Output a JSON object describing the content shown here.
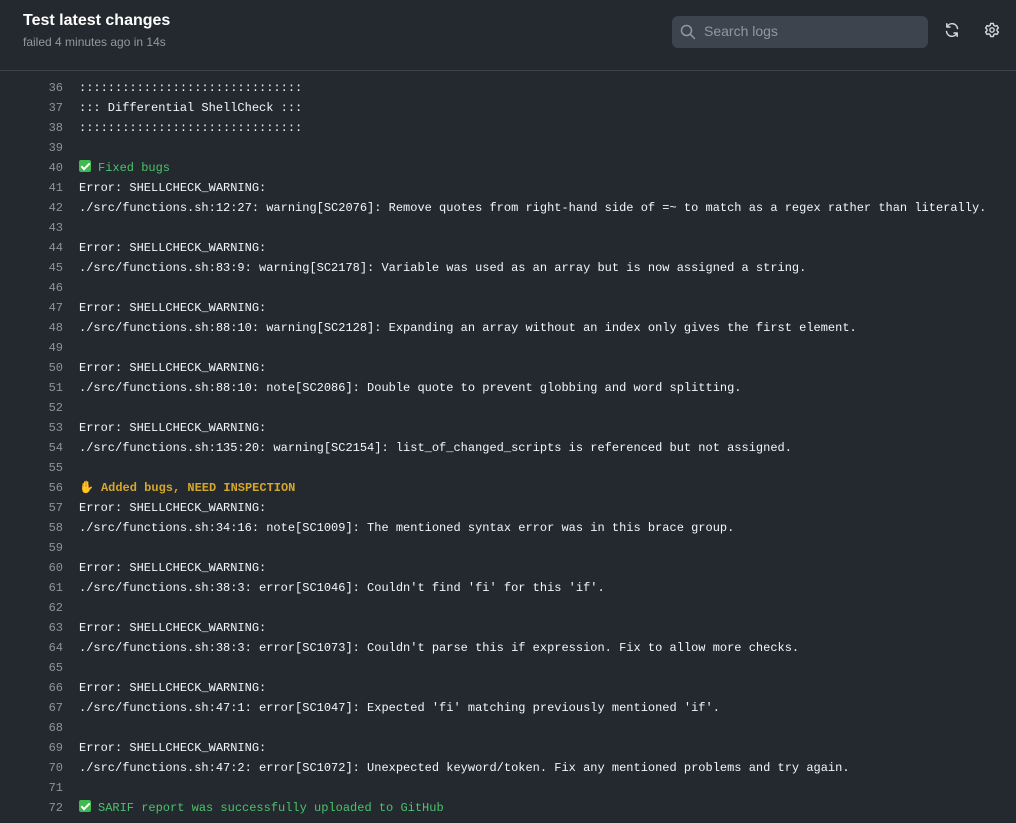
{
  "header": {
    "title": "Test latest changes",
    "subtitle": "failed 4 minutes ago in 14s"
  },
  "search": {
    "placeholder": "Search logs",
    "icon": "search-icon"
  },
  "actions": {
    "refresh_icon": "refresh-icon",
    "settings_icon": "gear-icon"
  },
  "colors": {
    "background": "#24292f",
    "search_bg": "#3d444d",
    "line_number": "#8b949e",
    "success_green": "#4ac26b",
    "warning_yellow": "#d4a72c"
  },
  "log_lines": [
    {
      "n": "36",
      "text": ":::::::::::::::::::::::::::::::",
      "style": "normal",
      "icon": ""
    },
    {
      "n": "37",
      "text": "::: Differential ShellCheck :::",
      "style": "normal",
      "icon": ""
    },
    {
      "n": "38",
      "text": ":::::::::::::::::::::::::::::::",
      "style": "normal",
      "icon": ""
    },
    {
      "n": "39",
      "text": "",
      "style": "normal",
      "icon": ""
    },
    {
      "n": "40",
      "text": "Fixed bugs",
      "style": "green",
      "icon": "check"
    },
    {
      "n": "41",
      "text": "Error: SHELLCHECK_WARNING:",
      "style": "normal",
      "icon": ""
    },
    {
      "n": "42",
      "text": "./src/functions.sh:12:27: warning[SC2076]: Remove quotes from right-hand side of =~ to match as a regex rather than literally.",
      "style": "normal",
      "icon": ""
    },
    {
      "n": "43",
      "text": "",
      "style": "normal",
      "icon": ""
    },
    {
      "n": "44",
      "text": "Error: SHELLCHECK_WARNING:",
      "style": "normal",
      "icon": ""
    },
    {
      "n": "45",
      "text": "./src/functions.sh:83:9: warning[SC2178]: Variable was used as an array but is now assigned a string.",
      "style": "normal",
      "icon": ""
    },
    {
      "n": "46",
      "text": "",
      "style": "normal",
      "icon": ""
    },
    {
      "n": "47",
      "text": "Error: SHELLCHECK_WARNING:",
      "style": "normal",
      "icon": ""
    },
    {
      "n": "48",
      "text": "./src/functions.sh:88:10: warning[SC2128]: Expanding an array without an index only gives the first element.",
      "style": "normal",
      "icon": ""
    },
    {
      "n": "49",
      "text": "",
      "style": "normal",
      "icon": ""
    },
    {
      "n": "50",
      "text": "Error: SHELLCHECK_WARNING:",
      "style": "normal",
      "icon": ""
    },
    {
      "n": "51",
      "text": "./src/functions.sh:88:10: note[SC2086]: Double quote to prevent globbing and word splitting.",
      "style": "normal",
      "icon": ""
    },
    {
      "n": "52",
      "text": "",
      "style": "normal",
      "icon": ""
    },
    {
      "n": "53",
      "text": "Error: SHELLCHECK_WARNING:",
      "style": "normal",
      "icon": ""
    },
    {
      "n": "54",
      "text": "./src/functions.sh:135:20: warning[SC2154]: list_of_changed_scripts is referenced but not assigned.",
      "style": "normal",
      "icon": ""
    },
    {
      "n": "55",
      "text": "",
      "style": "normal",
      "icon": ""
    },
    {
      "n": "56",
      "text": "Added bugs, NEED INSPECTION",
      "style": "yellow",
      "icon": "hand"
    },
    {
      "n": "57",
      "text": "Error: SHELLCHECK_WARNING:",
      "style": "normal",
      "icon": ""
    },
    {
      "n": "58",
      "text": "./src/functions.sh:34:16: note[SC1009]: The mentioned syntax error was in this brace group.",
      "style": "normal",
      "icon": ""
    },
    {
      "n": "59",
      "text": "",
      "style": "normal",
      "icon": ""
    },
    {
      "n": "60",
      "text": "Error: SHELLCHECK_WARNING:",
      "style": "normal",
      "icon": ""
    },
    {
      "n": "61",
      "text": "./src/functions.sh:38:3: error[SC1046]: Couldn't find 'fi' for this 'if'.",
      "style": "normal",
      "icon": ""
    },
    {
      "n": "62",
      "text": "",
      "style": "normal",
      "icon": ""
    },
    {
      "n": "63",
      "text": "Error: SHELLCHECK_WARNING:",
      "style": "normal",
      "icon": ""
    },
    {
      "n": "64",
      "text": "./src/functions.sh:38:3: error[SC1073]: Couldn't parse this if expression. Fix to allow more checks.",
      "style": "normal",
      "icon": ""
    },
    {
      "n": "65",
      "text": "",
      "style": "normal",
      "icon": ""
    },
    {
      "n": "66",
      "text": "Error: SHELLCHECK_WARNING:",
      "style": "normal",
      "icon": ""
    },
    {
      "n": "67",
      "text": "./src/functions.sh:47:1: error[SC1047]: Expected 'fi' matching previously mentioned 'if'.",
      "style": "normal",
      "icon": ""
    },
    {
      "n": "68",
      "text": "",
      "style": "normal",
      "icon": ""
    },
    {
      "n": "69",
      "text": "Error: SHELLCHECK_WARNING:",
      "style": "normal",
      "icon": ""
    },
    {
      "n": "70",
      "text": "./src/functions.sh:47:2: error[SC1072]: Unexpected keyword/token. Fix any mentioned problems and try again.",
      "style": "normal",
      "icon": ""
    },
    {
      "n": "71",
      "text": "",
      "style": "normal",
      "icon": ""
    },
    {
      "n": "72",
      "text": "SARIF report was successfully uploaded to GitHub",
      "style": "green",
      "icon": "check"
    }
  ]
}
